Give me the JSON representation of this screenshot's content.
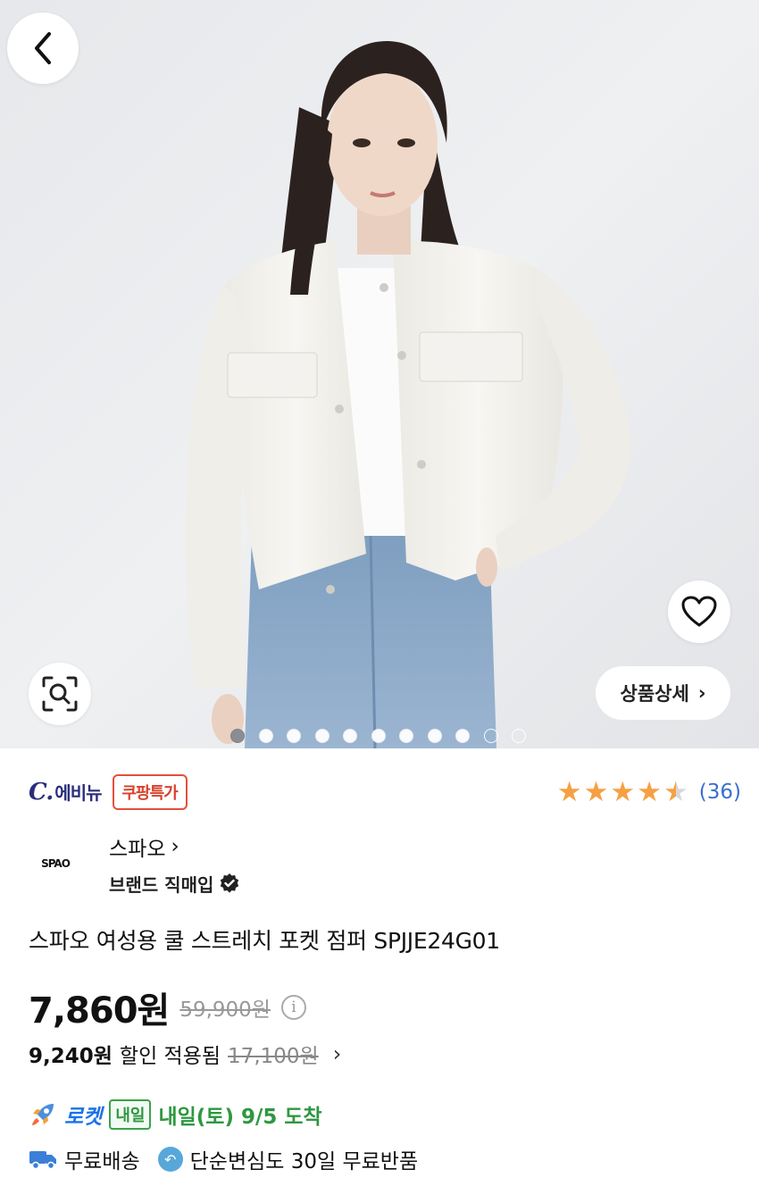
{
  "hero": {
    "detail_label": "상품상세",
    "detail_chevron": "›",
    "back_icon": "chevron-left-icon",
    "heart_icon": "heart-icon",
    "lens_icon": "image-search-icon",
    "carousel": {
      "total": 11,
      "active_index": 0
    }
  },
  "seller": {
    "logo_mark": "C.",
    "logo_name": "에비뉴",
    "badge": "쿠팡특가"
  },
  "rating": {
    "stars": 4.5,
    "max": 5,
    "count": "(36)",
    "color": "#f6a043"
  },
  "brand": {
    "logo": "SPAO",
    "name": "스파오",
    "name_chevron": "›",
    "subtitle": "브랜드 직매입"
  },
  "product": {
    "title": "스파오 여성용 쿨 스트레치 포켓 점퍼 SPJJE24G01",
    "price": "7,860원",
    "original_price": "59,900원",
    "info_icon": "ⓘ",
    "discount_price": "9,240원",
    "discount_label": "할인 적용됨",
    "discount_original": "17,100원",
    "discount_chevron": "›"
  },
  "delivery": {
    "rocket_label": "로켓",
    "naeil_badge": "내일",
    "arrival": "내일(토) 9/5 도착",
    "free_shipping": "무료배송",
    "free_return": "단순변심도 30일 무료반품"
  },
  "colors": {
    "accent_blue": "#3a6fcf",
    "badge_red": "#e4503c",
    "arrival_green": "#2e9840"
  }
}
